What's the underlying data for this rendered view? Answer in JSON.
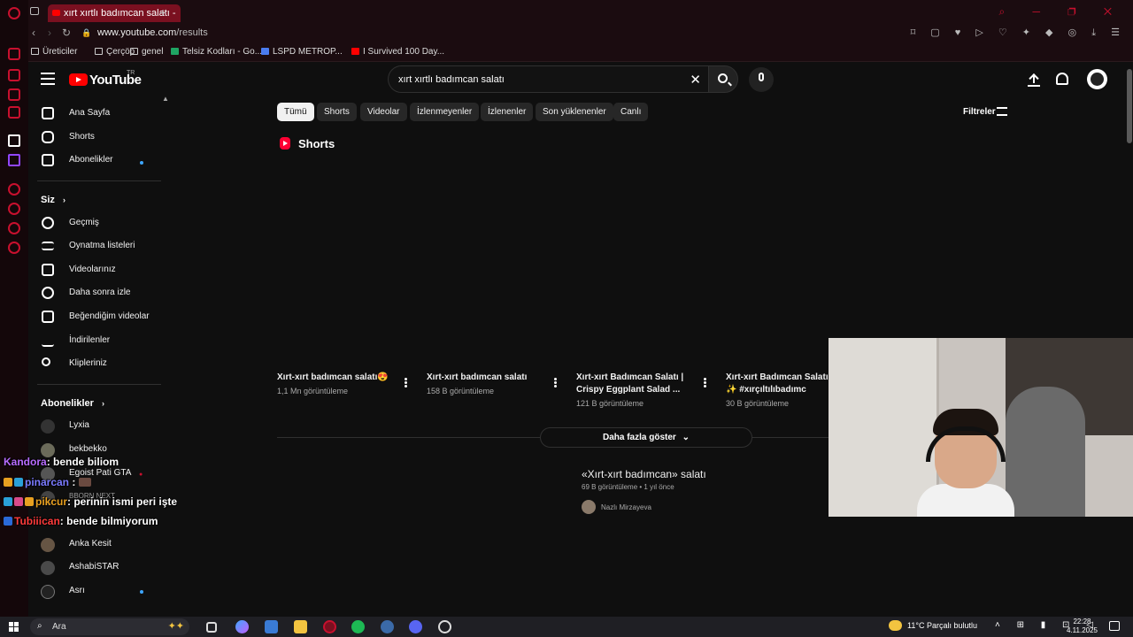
{
  "browser": {
    "tab_title": "xırt xırtlı badımcan salatı -",
    "url_host": "www.youtube.com",
    "url_path": "/results",
    "bookmarks": [
      "Üreticiler",
      "Çerçöp",
      "genel",
      "Telsiz Kodları - Go...",
      "LSPD METROP...",
      "I Survived 100 Day..."
    ]
  },
  "youtube": {
    "logo_text": "YouTube",
    "logo_country": "TR",
    "search_query": "xırt xırtlı badımcan salatı",
    "guide": {
      "main": [
        "Ana Sayfa",
        "Shorts",
        "Abonelikler"
      ],
      "you_heading": "Siz",
      "you_items": [
        "Geçmiş",
        "Oynatma listeleri",
        "Videolarınız",
        "Daha sonra izle",
        "Beğendiğim videolar",
        "İndirilenler",
        "Klipleriniz"
      ],
      "subs_heading": "Abonelikler",
      "channels": [
        "Lyxia",
        "bekbekko",
        "Egoist Pati GTA",
        "BBORN NEXT",
        "",
        "Anka Kesit",
        "AshabiSTAR",
        "Asrı"
      ]
    },
    "chips": [
      "Tümü",
      "Shorts",
      "Videolar",
      "İzlenmeyenler",
      "İzlenenler",
      "Son yüklenenler",
      "Canlı"
    ],
    "filters_label": "Filtreler",
    "shorts_heading": "Shorts",
    "shorts": [
      {
        "title": "Xırt-xırt badımcan salatı😍",
        "views": "1,1 Mn görüntüleme"
      },
      {
        "title": "Xırt-xırt badımcan salatı",
        "views": "158 B görüntüleme"
      },
      {
        "title": "Xırt-xırt Badımcan Salatı | Crispy Eggplant Salad ...",
        "views": "121 B görüntüleme"
      },
      {
        "title": "Xırt-xırt Badımcan Salatı ✨ #xırçıltılıbadımc",
        "views": "30 B görüntüleme"
      }
    ],
    "show_more": "Daha fazla göster",
    "video": {
      "title": "«Xırt-xırt badımcan» salatı",
      "meta": "69 B görüntüleme • 1 yıl önce",
      "channel": "Nazlı Mirzayeva"
    }
  },
  "chat": [
    {
      "user": "Kandora",
      "msg": ": bende biliom"
    },
    {
      "user": "pinarcan",
      "msg": " :"
    },
    {
      "user": "pikcur",
      "msg": ": perinin ismi peri işte"
    },
    {
      "user": "Tubiiican",
      "msg": ": bende bilmiyorum"
    }
  ],
  "taskbar": {
    "search_placeholder": "Ara",
    "weather": "11°C  Parçalı bulutlu",
    "time": "22:28",
    "date": "4.11.2025"
  }
}
